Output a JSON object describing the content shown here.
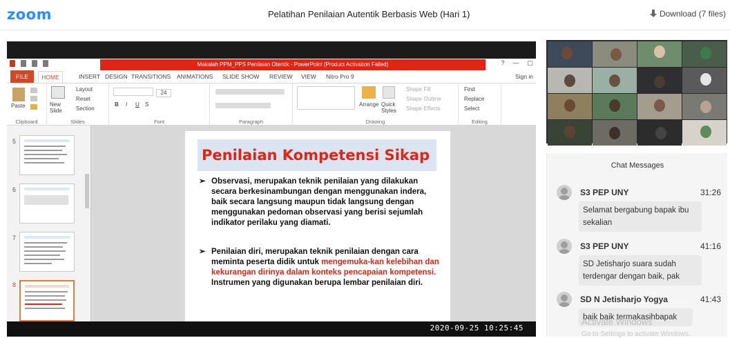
{
  "app": {
    "logo": "zoom",
    "title": "Pelatihan Penilaian Autentik Berbasis Web (Hari 1)",
    "download": "Download (7 files)",
    "brand_color": "#2d8cff"
  },
  "powerpoint": {
    "window_title": "Makalah PPM_PPS Penilaian Otentik - PowerPoint (Product Activation Failed)",
    "help_glyph": "?",
    "tabs": [
      "FILE",
      "HOME",
      "INSERT",
      "DESIGN",
      "TRANSITIONS",
      "ANIMATIONS",
      "SLIDE SHOW",
      "REVIEW",
      "VIEW",
      "Nitro Pro 9"
    ],
    "sign_in": "Sign in",
    "groups": {
      "clipboard": "Clipboard",
      "slides": "Slides",
      "font": "Font",
      "paragraph": "Paragraph",
      "drawing": "Drawing",
      "editing": "Editing"
    },
    "tools": {
      "paste": "Paste",
      "new_slide": "New Slide",
      "layout": "Layout",
      "reset": "Reset",
      "section": "Section",
      "font_size": "24",
      "arrange": "Arrange",
      "quick_styles": "Quick Styles",
      "shape_fill": "Shape Fill",
      "shape_outline": "Shape Outline",
      "shape_effects": "Shape Effects",
      "find": "Find",
      "replace": "Replace",
      "select": "Select"
    },
    "thumbnails": [
      {
        "num": "5",
        "selected": false
      },
      {
        "num": "6",
        "selected": false
      },
      {
        "num": "7",
        "selected": false
      },
      {
        "num": "8",
        "selected": true
      }
    ],
    "slide": {
      "title": "Penilaian Kompetensi Sikap",
      "bullet_glyph": "➢",
      "bullet1": "Observasi, merupakan teknik penilaian yang dilakukan secara berkesinambungan dengan menggunakan indera, baik secara langsung maupun tidak langsung dengan menggunakan pedoman observasi yang berisi sejumlah indikator perilaku yang diamati.",
      "bullet2_a": "Penilaian diri, merupakan teknik penilaian dengan cara meminta peserta didik untuk ",
      "bullet2_red": "mengemuka-kan kelebihan dan kekurangan dirinya dalam konteks pencapaian kompetensi.",
      "bullet2_b": " Instrumen yang digunakan berupa lembar penilaian diri."
    },
    "timestamp": "2020-09-25  10:25:45"
  },
  "chat": {
    "header": "Chat Messages",
    "messages": [
      {
        "sender": "S3 PEP UNY",
        "time": "31:26",
        "text": "Selamat bergabung bapak ibu sekalian"
      },
      {
        "sender": "S3 PEP UNY",
        "time": "41:16",
        "text": "SD Jetisharjo suara sudah terdengar dengan baik, pak"
      },
      {
        "sender": "SD N Jetisharjo Yogya",
        "time": "41:43",
        "text": "baik baik termakasihbapak"
      }
    ],
    "watermark": "Activate Windows",
    "watermark2": "Go to Settings to activate Windows."
  }
}
